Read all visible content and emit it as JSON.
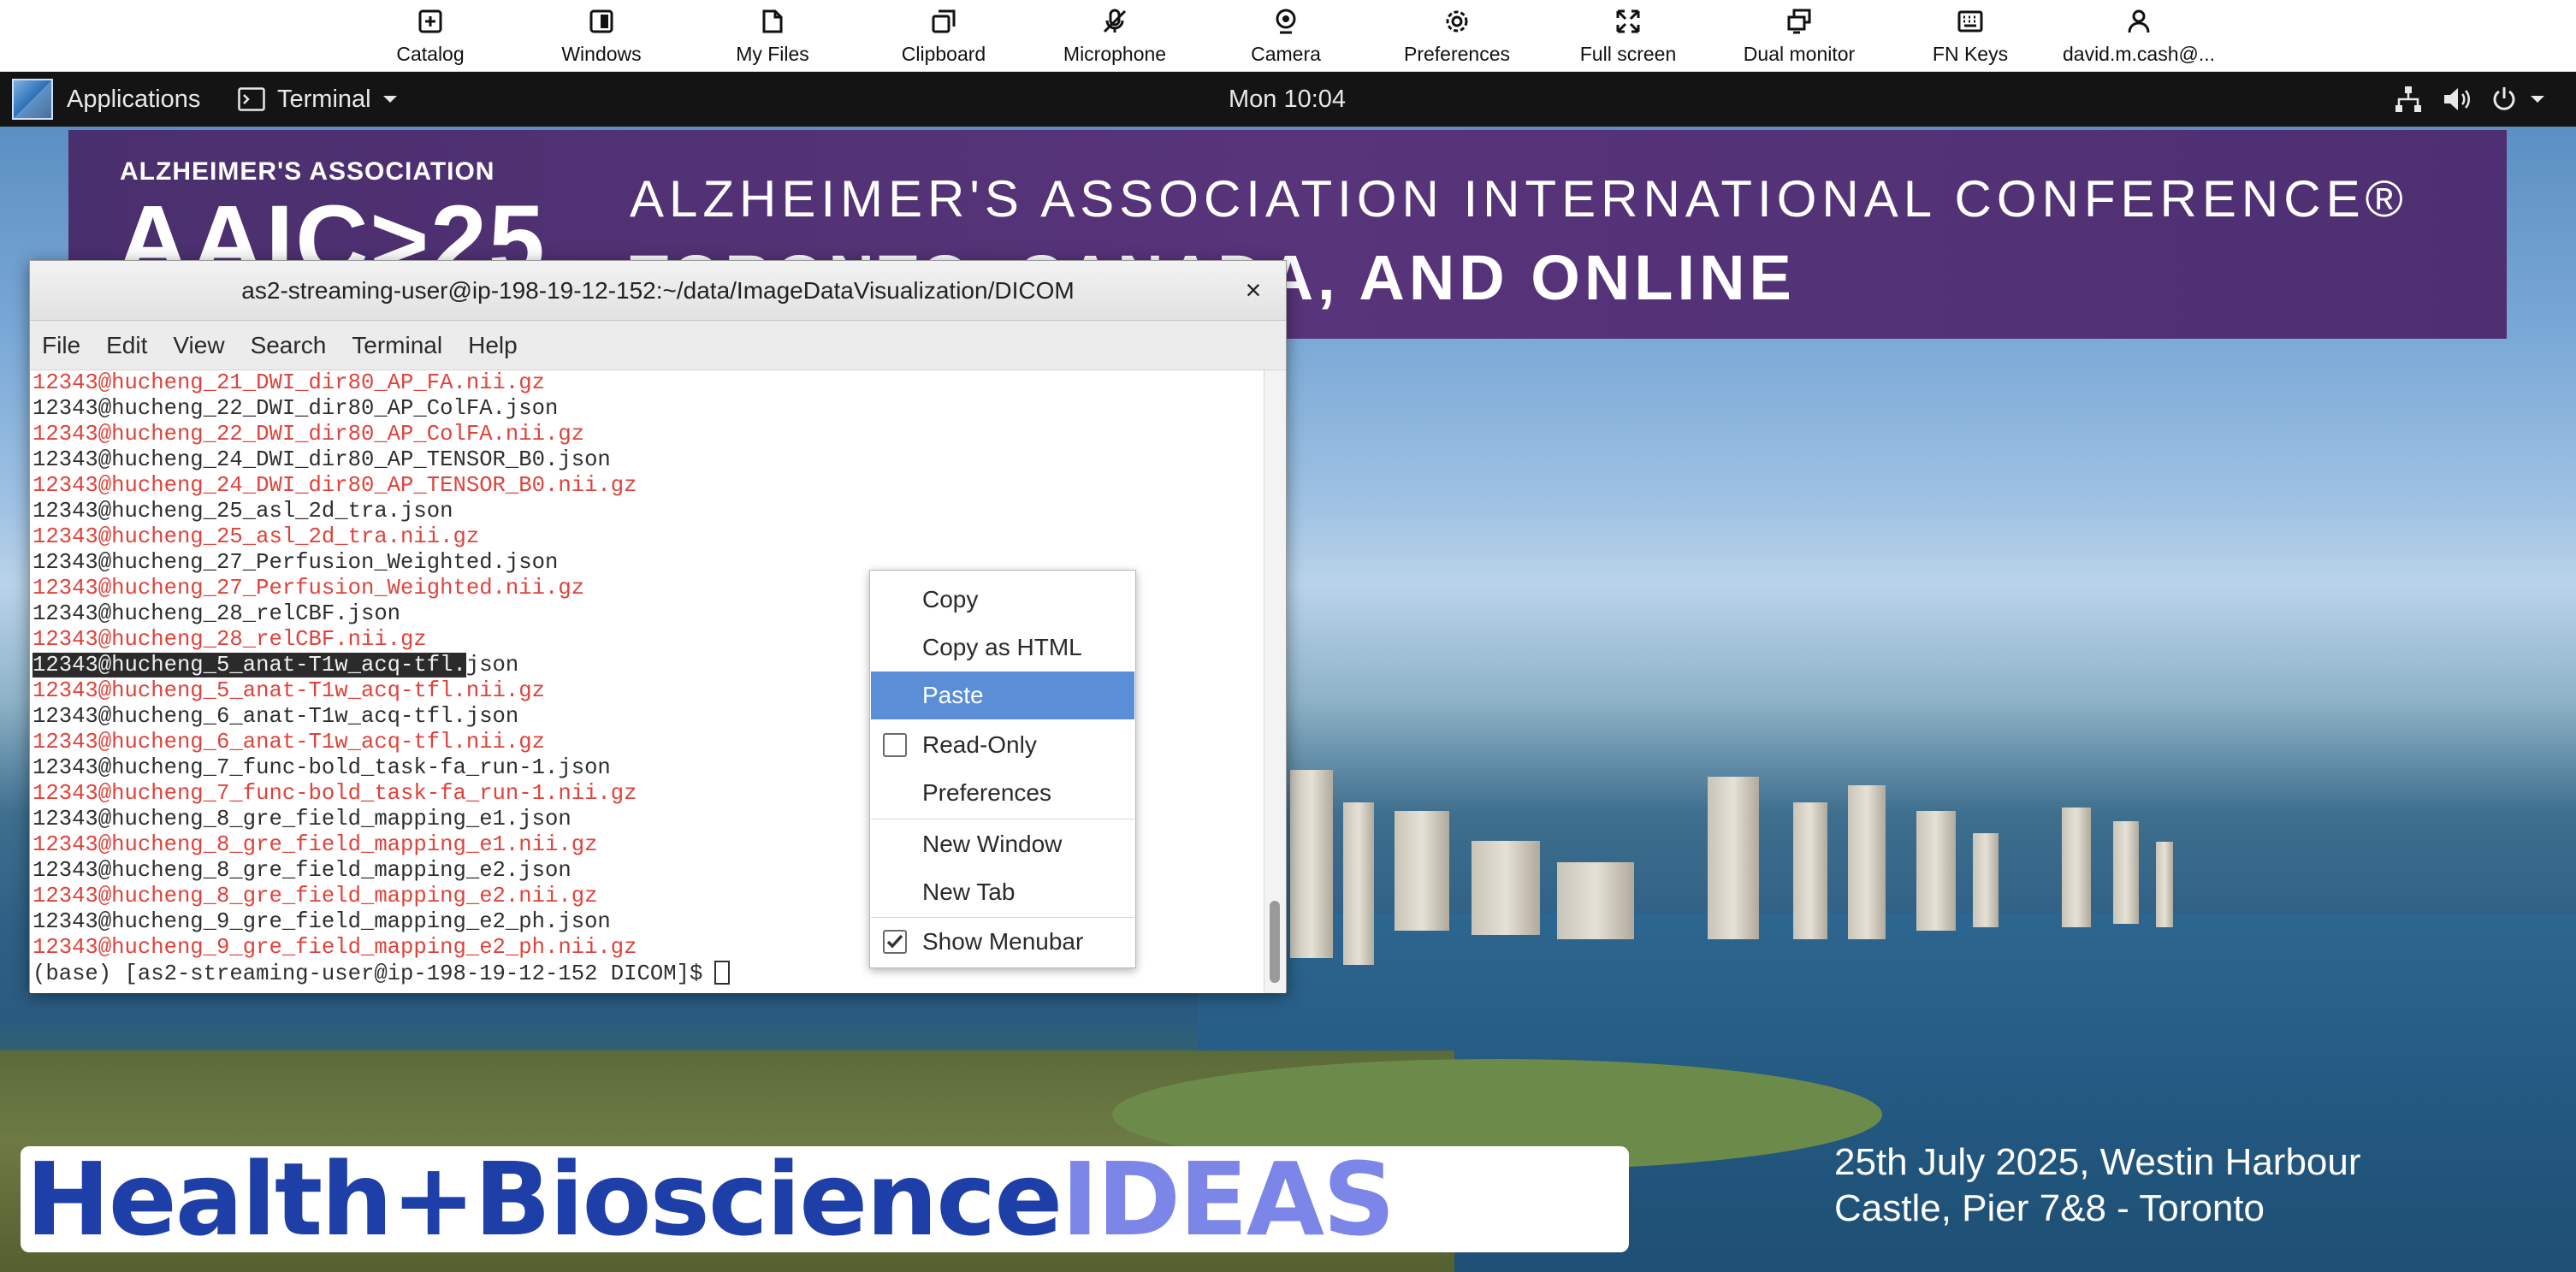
{
  "toolbar": {
    "items": [
      {
        "label": "Catalog",
        "icon": "plus-square-icon"
      },
      {
        "label": "Windows",
        "icon": "windows-icon"
      },
      {
        "label": "My Files",
        "icon": "folder-icon"
      },
      {
        "label": "Clipboard",
        "icon": "clipboard-icon"
      },
      {
        "label": "Microphone",
        "icon": "microphone-icon"
      },
      {
        "label": "Camera",
        "icon": "camera-icon"
      },
      {
        "label": "Preferences",
        "icon": "gear-icon"
      },
      {
        "label": "Full screen",
        "icon": "fullscreen-icon"
      },
      {
        "label": "Dual monitor",
        "icon": "dual-monitor-icon"
      },
      {
        "label": "FN Keys",
        "icon": "keyboard-icon"
      },
      {
        "label": "david.m.cash@...",
        "icon": "user-icon"
      }
    ]
  },
  "panel": {
    "applications": "Applications",
    "app_menu": "Terminal",
    "clock": "Mon 10:04"
  },
  "wallpaper": {
    "banner_org": "ALZHEIMER'S ASSOCIATION",
    "banner_aaic": "AAIC>25",
    "banner_line1": "ALZHEIMER'S ASSOCIATION INTERNATIONAL CONFERENCE®",
    "banner_line2": "TORONTO, CANADA, AND ONLINE",
    "logo_main": "Health+Bioscience",
    "logo_accent": "IDEAS",
    "event_line1": "25th July 2025, Westin Harbour",
    "event_line2": "Castle, Pier 7&8 - Toronto"
  },
  "terminal": {
    "title": "as2-streaming-user@ip-198-19-12-152:~/data/ImageDataVisualization/DICOM",
    "close_symbol": "×",
    "menus": [
      "File",
      "Edit",
      "View",
      "Search",
      "Terminal",
      "Help"
    ],
    "lines": [
      {
        "text": "12343@hucheng_21_DWI_dir80_AP_FA.nii.gz",
        "kind": "red"
      },
      {
        "text": "12343@hucheng_22_DWI_dir80_AP_ColFA.json",
        "kind": "normal"
      },
      {
        "text": "12343@hucheng_22_DWI_dir80_AP_ColFA.nii.gz",
        "kind": "red"
      },
      {
        "text": "12343@hucheng_24_DWI_dir80_AP_TENSOR_B0.json",
        "kind": "normal"
      },
      {
        "text": "12343@hucheng_24_DWI_dir80_AP_TENSOR_B0.nii.gz",
        "kind": "red"
      },
      {
        "text": "12343@hucheng_25_asl_2d_tra.json",
        "kind": "normal"
      },
      {
        "text": "12343@hucheng_25_asl_2d_tra.nii.gz",
        "kind": "red"
      },
      {
        "text": "12343@hucheng_27_Perfusion_Weighted.json",
        "kind": "normal"
      },
      {
        "text": "12343@hucheng_27_Perfusion_Weighted.nii.gz",
        "kind": "red"
      },
      {
        "text": "12343@hucheng_28_relCBF.json",
        "kind": "normal"
      },
      {
        "text": "12343@hucheng_28_relCBF.nii.gz",
        "kind": "red"
      },
      {
        "text": "json",
        "selected": "12343@hucheng_5_anat-T1w_acq-tfl.",
        "kind": "normal"
      },
      {
        "text": "12343@hucheng_5_anat-T1w_acq-tfl.nii.gz",
        "kind": "red"
      },
      {
        "text": "12343@hucheng_6_anat-T1w_acq-tfl.json",
        "kind": "normal"
      },
      {
        "text": "12343@hucheng_6_anat-T1w_acq-tfl.nii.gz",
        "kind": "red"
      },
      {
        "text": "12343@hucheng_7_func-bold_task-fa_run-1.json",
        "kind": "normal"
      },
      {
        "text": "12343@hucheng_7_func-bold_task-fa_run-1.nii.gz",
        "kind": "red"
      },
      {
        "text": "12343@hucheng_8_gre_field_mapping_e1.json",
        "kind": "normal"
      },
      {
        "text": "12343@hucheng_8_gre_field_mapping_e1.nii.gz",
        "kind": "red"
      },
      {
        "text": "12343@hucheng_8_gre_field_mapping_e2.json",
        "kind": "normal"
      },
      {
        "text": "12343@hucheng_8_gre_field_mapping_e2.nii.gz",
        "kind": "red"
      },
      {
        "text": "12343@hucheng_9_gre_field_mapping_e2_ph.json",
        "kind": "normal"
      },
      {
        "text": "12343@hucheng_9_gre_field_mapping_e2_ph.nii.gz",
        "kind": "red"
      }
    ],
    "prompt": "(base) [as2-streaming-user@ip-198-19-12-152 DICOM]$"
  },
  "context_menu": {
    "copy": "Copy",
    "copy_html": "Copy as HTML",
    "paste": "Paste",
    "read_only": "Read-Only",
    "read_only_checked": false,
    "preferences": "Preferences",
    "new_window": "New Window",
    "new_tab": "New Tab",
    "show_menubar": "Show Menubar",
    "show_menubar_checked": true,
    "highlighted": "paste"
  },
  "colors": {
    "panel": "#141414",
    "menu_highlight": "#5a8fd8",
    "terminal_red": "#e0423a",
    "banner_purple": "#4a2f6e",
    "logo_blue": "#1f3fa8",
    "logo_accent": "#7b86e8"
  }
}
